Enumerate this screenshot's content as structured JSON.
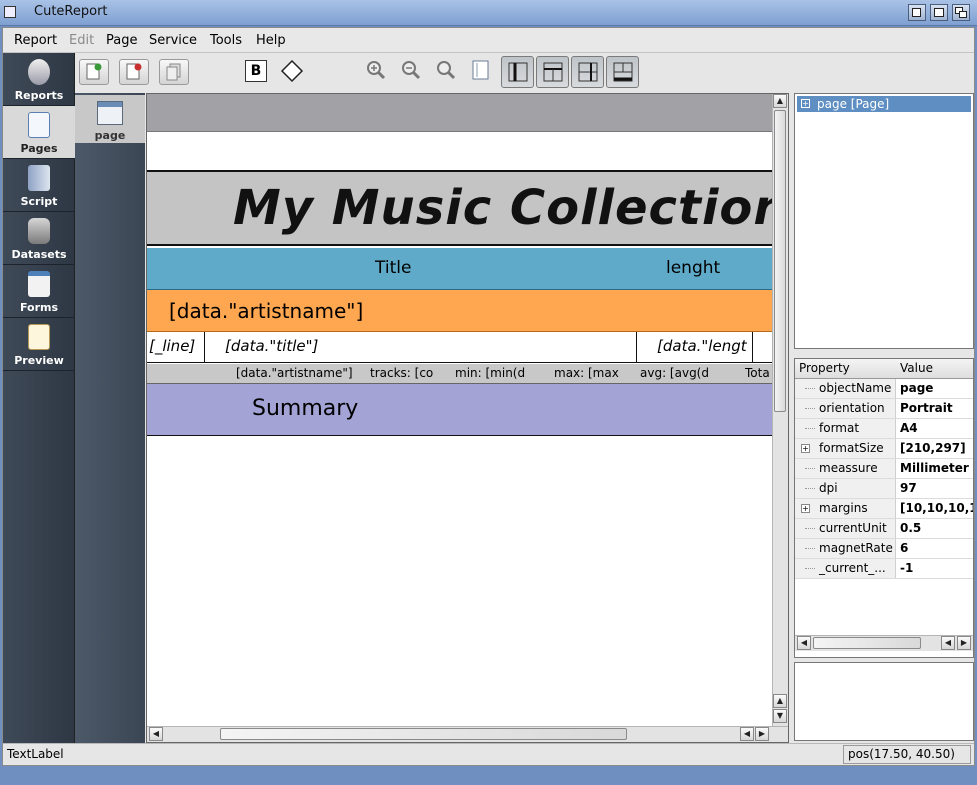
{
  "window": {
    "title": "CuteReport"
  },
  "menu": [
    "Report",
    "Edit",
    "Page",
    "Service",
    "Tools",
    "Help"
  ],
  "modules": [
    {
      "label": "Reports",
      "icon": "reports-icon"
    },
    {
      "label": "Pages",
      "icon": "pages-icon"
    },
    {
      "label": "Script",
      "icon": "script-icon"
    },
    {
      "label": "Datasets",
      "icon": "datasets-icon"
    },
    {
      "label": "Forms",
      "icon": "forms-icon"
    },
    {
      "label": "Preview",
      "icon": "preview-icon"
    }
  ],
  "active_module": "Pages",
  "pages": [
    {
      "label": "page"
    }
  ],
  "toolbar": {
    "bold_label": "B",
    "icons": [
      "new-page-icon",
      "delete-page-icon",
      "clone-page-icon",
      "bold-icon",
      "diamond-icon",
      "zoom-in-icon",
      "zoom-out-icon",
      "zoom-reset-icon",
      "page-settings-icon",
      "layout-left-icon",
      "layout-grid-icon",
      "layout-split-icon",
      "layout-bottom-icon"
    ]
  },
  "report": {
    "title": "My Music Collection",
    "header_cols": [
      "Title",
      "lenght"
    ],
    "group_field": "[data.\"artistname\"]",
    "detail_cells": [
      "[_line]",
      "[data.\"title\"]",
      "[data.\"lengt"
    ],
    "footer_cells": [
      "[data.\"artistname\"]",
      "tracks: [co",
      "min: [min(d",
      "max: [max",
      "avg: [avg(d",
      "Tota"
    ],
    "summary": "Summary"
  },
  "object_tree": {
    "node": "page [Page]"
  },
  "properties": {
    "header": [
      "Property",
      "Value"
    ],
    "rows": [
      {
        "name": "objectName",
        "value": "page",
        "expandable": false
      },
      {
        "name": "orientation",
        "value": "Portrait",
        "expandable": false
      },
      {
        "name": "format",
        "value": "A4",
        "expandable": false
      },
      {
        "name": "formatSize",
        "value": "[210,297]",
        "expandable": true
      },
      {
        "name": "meassure",
        "value": "Millimeter",
        "expandable": false
      },
      {
        "name": "dpi",
        "value": "97",
        "expandable": false
      },
      {
        "name": "margins",
        "value": "[10,10,10,1",
        "expandable": true
      },
      {
        "name": "currentUnit",
        "value": "0.5",
        "expandable": false
      },
      {
        "name": "magnetRate",
        "value": "6",
        "expandable": false
      },
      {
        "name": "_current_...",
        "value": "-1",
        "expandable": false
      }
    ]
  },
  "status": {
    "left": "TextLabel",
    "position": "pos(17.50, 40.50)"
  }
}
